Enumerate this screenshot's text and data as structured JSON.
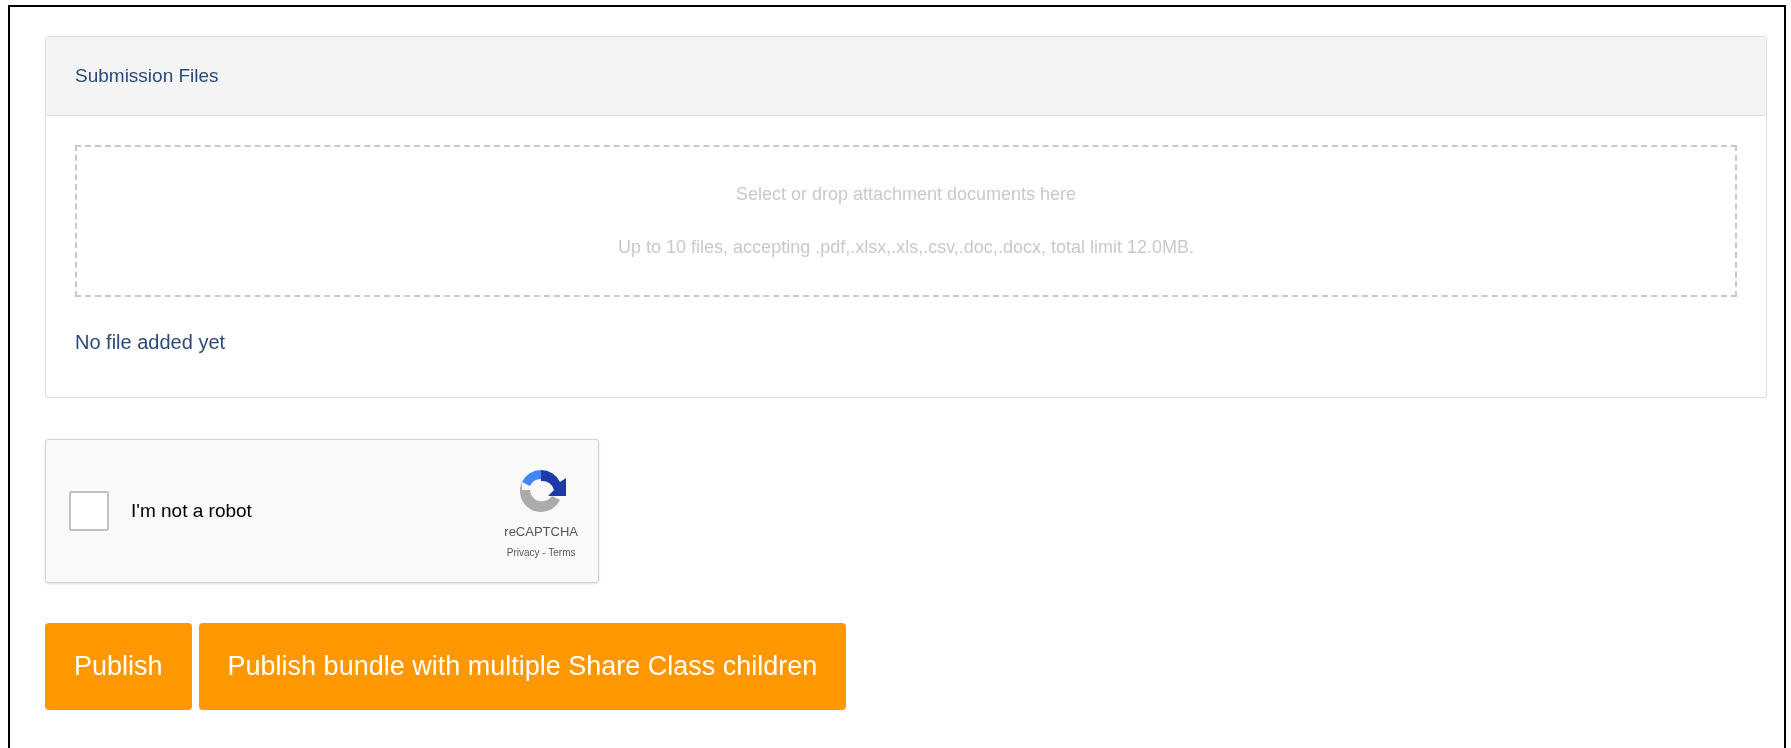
{
  "panel": {
    "title": "Submission Files",
    "dropzone": {
      "prompt": "Select or drop attachment documents here",
      "hint": "Up to 10 files, accepting .pdf,.xlsx,.xls,.csv,.doc,.docx, total limit 12.0MB."
    },
    "status": "No file added yet"
  },
  "captcha": {
    "label": "I'm not a robot",
    "checked": false,
    "brand": "reCAPTCHA",
    "links": "Privacy - Terms"
  },
  "buttons": [
    "Publish",
    "Publish bundle with multiple Share Class children"
  ]
}
